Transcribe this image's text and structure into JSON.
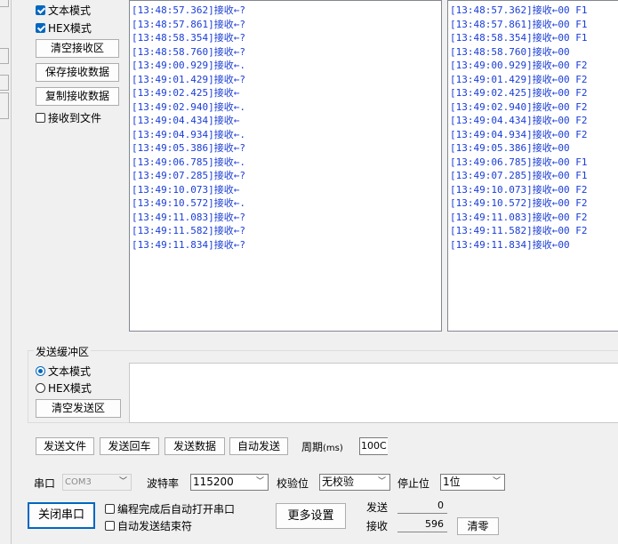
{
  "receive": {
    "text_mode_label": "文本模式",
    "hex_mode_label": "HEX模式",
    "clear_btn": "清空接收区",
    "save_btn": "保存接收数据",
    "copy_btn": "复制接收数据",
    "to_file_label": "接收到文件",
    "text_lines": [
      "[13:48:57.362]接收←?",
      "[13:48:57.861]接收←?",
      "[13:48:58.354]接收←?",
      "[13:48:58.760]接收←?",
      "[13:49:00.929]接收←.",
      "[13:49:01.429]接收←?",
      "[13:49:02.425]接收←",
      "[13:49:02.940]接收←.",
      "[13:49:04.434]接收←",
      "[13:49:04.934]接收←.",
      "[13:49:05.386]接收←?",
      "[13:49:06.785]接收←.",
      "[13:49:07.285]接收←?",
      "[13:49:10.073]接收←",
      "[13:49:10.572]接收←.",
      "[13:49:11.083]接收←?",
      "[13:49:11.582]接收←?",
      "[13:49:11.834]接收←?"
    ],
    "hex_lines": [
      "[13:48:57.362]接收←00 F1",
      "[13:48:57.861]接收←00 F1",
      "[13:48:58.354]接收←00 F1",
      "[13:48:58.760]接收←00",
      "[13:49:00.929]接收←00 F2",
      "[13:49:01.429]接收←00 F2",
      "[13:49:02.425]接收←00 F2",
      "[13:49:02.940]接收←00 F2",
      "[13:49:04.434]接收←00 F2",
      "[13:49:04.934]接收←00 F2",
      "[13:49:05.386]接收←00",
      "[13:49:06.785]接收←00 F1",
      "[13:49:07.285]接收←00 F1",
      "[13:49:10.073]接收←00 F2",
      "[13:49:10.572]接收←00 F2",
      "[13:49:11.083]接收←00 F2",
      "[13:49:11.582]接收←00 F2",
      "[13:49:11.834]接收←00"
    ]
  },
  "send": {
    "group_title": "发送缓冲区",
    "text_mode_label": "文本模式",
    "hex_mode_label": "HEX模式",
    "clear_btn": "清空发送区",
    "send_file_btn": "发送文件",
    "send_enter_btn": "发送回车",
    "send_data_btn": "发送数据",
    "auto_send_btn": "自动发送",
    "period_label": "周期",
    "period_unit": "(ms)",
    "period_value": "100C"
  },
  "port": {
    "port_label": "串口",
    "port_value": "COM3",
    "baud_label": "波特率",
    "baud_value": "115200",
    "parity_label": "校验位",
    "parity_value": "无校验",
    "stop_label": "停止位",
    "stop_value": "1位",
    "close_btn": "关闭串口",
    "auto_open_label": "编程完成后自动打开串口",
    "auto_end_label": "自动发送结束符",
    "more_btn": "更多设置",
    "sent_label": "发送",
    "sent_value": "0",
    "recv_label": "接收",
    "recv_value": "596",
    "clear_count_btn": "清零"
  },
  "colors": {
    "accent": "#0067c0",
    "log_text": "#1a3dd6"
  }
}
